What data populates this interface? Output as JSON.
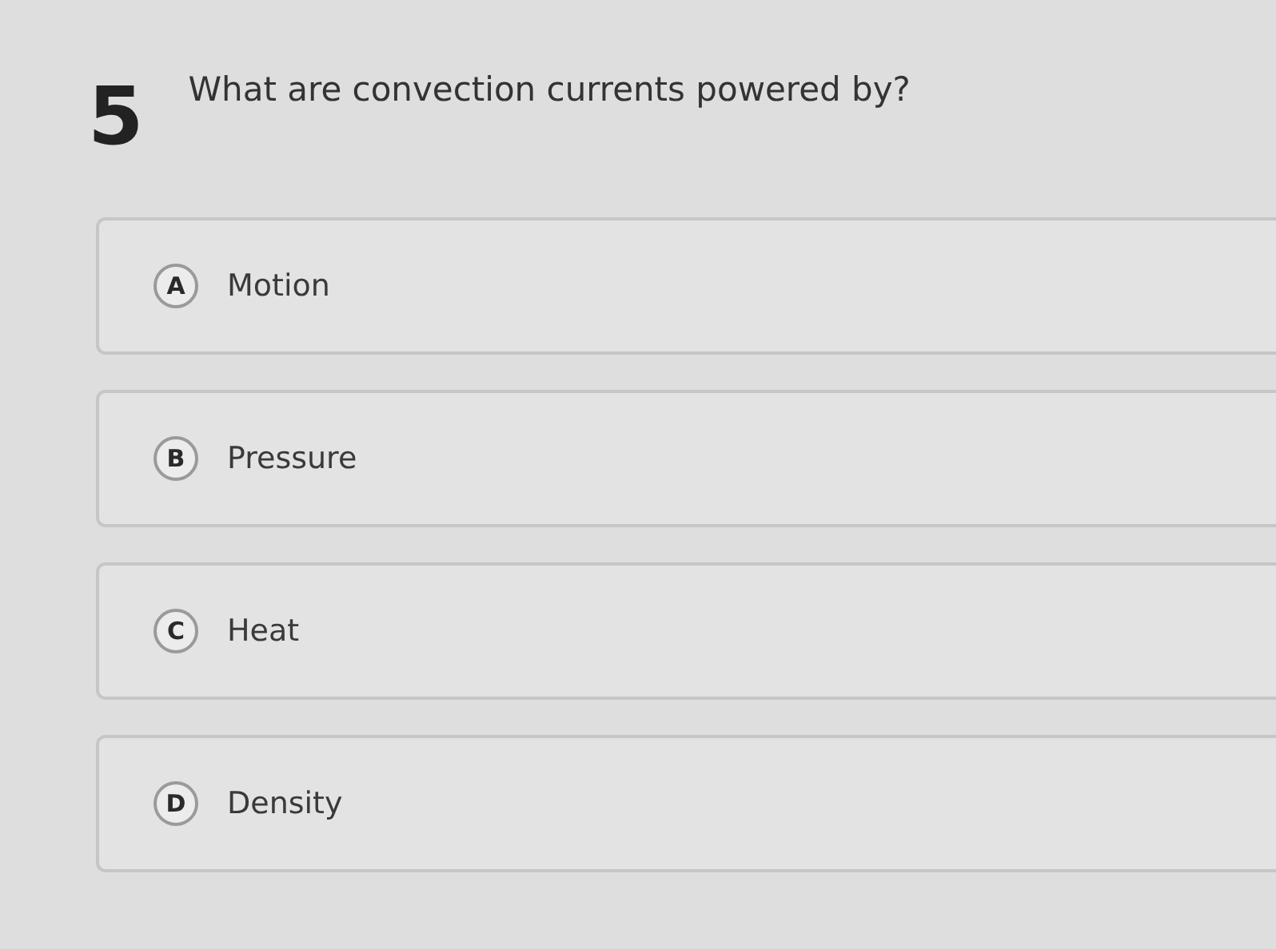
{
  "question": {
    "number": "5",
    "text": "What are convection currents powered by?"
  },
  "options": [
    {
      "letter": "A",
      "text": "Motion"
    },
    {
      "letter": "B",
      "text": "Pressure"
    },
    {
      "letter": "C",
      "text": "Heat"
    },
    {
      "letter": "D",
      "text": "Density"
    }
  ]
}
